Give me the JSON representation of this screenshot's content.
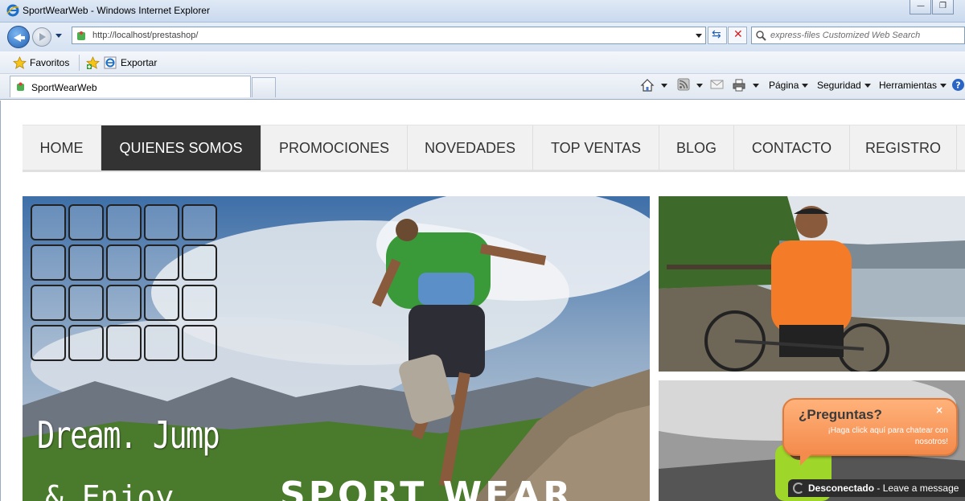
{
  "window": {
    "title": "SportWearWeb - Windows Internet Explorer"
  },
  "address_bar": {
    "url": "http://localhost/prestashop/"
  },
  "search_bar": {
    "placeholder": "express-files Customized Web Search"
  },
  "favorites_bar": {
    "favorites_label": "Favoritos",
    "export_label": "Exportar"
  },
  "tab": {
    "label": "SportWearWeb"
  },
  "command_bar": {
    "page_label": "Página",
    "security_label": "Seguridad",
    "tools_label": "Herramientas"
  },
  "site_menu": {
    "items": [
      {
        "label": "HOME"
      },
      {
        "label": "QUIENES SOMOS"
      },
      {
        "label": "PROMOCIONES"
      },
      {
        "label": "NOVEDADES"
      },
      {
        "label": "TOP VENTAS"
      },
      {
        "label": "BLOG"
      },
      {
        "label": "CONTACTO"
      },
      {
        "label": "REGISTRO"
      }
    ],
    "active_index": 1
  },
  "hero": {
    "headline": "Dream. Jump",
    "line2_left": "& Enjoy",
    "line2_right": "SPORT WEAR"
  },
  "chat": {
    "title": "¿Preguntas?",
    "subtitle": "¡Haga click aquí para chatear con nosotros!",
    "status": "Desconectado",
    "status_action": "- Leave a message",
    "close_symbol": "×"
  },
  "colors": {
    "menu_active_bg": "#333333",
    "chat_orange": "#f48a4c",
    "ie_chrome": "#dfe9f5"
  }
}
